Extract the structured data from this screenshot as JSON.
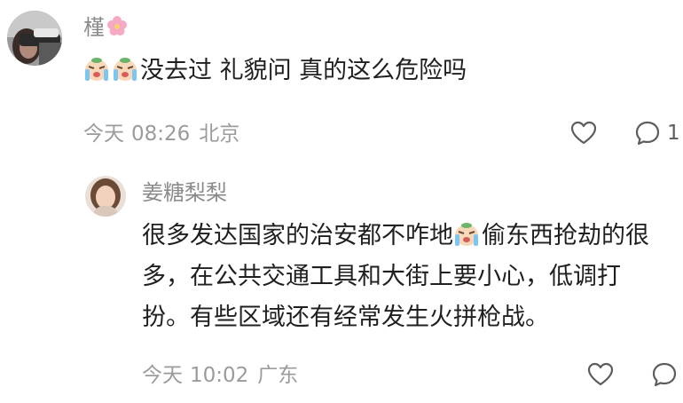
{
  "comment": {
    "username": "槿",
    "name_emoji": "cherry-blossom-emoji",
    "emojis": [
      "crying-face-emoji",
      "crying-face-emoji"
    ],
    "text": "没去过 礼貌问 真的这么危险吗",
    "date": "今天",
    "time": "08:26",
    "location": "北京",
    "reply_count": "1"
  },
  "reply": {
    "username": "姜糖梨梨",
    "line1_before": "很多发达国家的治安都不咋地",
    "line1_emoji": "crying-face-emoji",
    "line1_after": "偷东西抢劫的很",
    "line2": "多，在公共交通工具和大街上要小心，低调打",
    "line3": "扮。有些区域还有经常发生火拼枪战。",
    "date": "今天",
    "time": "10:02",
    "location": "广东"
  },
  "colors": {
    "meta_gray": "#9b9b9b",
    "name_gray": "#8a8a8a",
    "text": "#1f1f1f"
  }
}
